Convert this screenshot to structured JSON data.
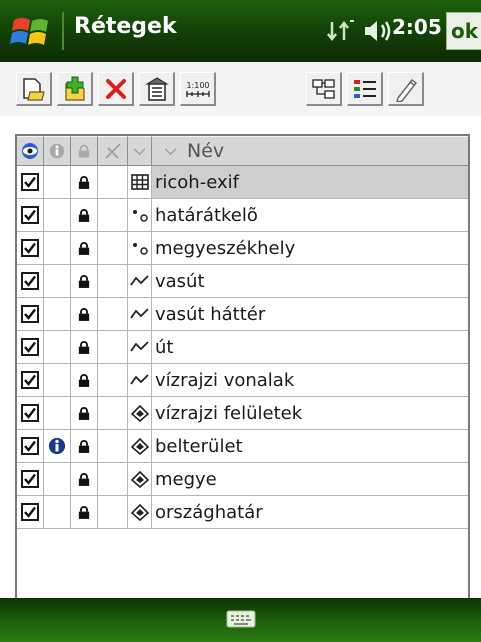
{
  "title_bar": {
    "title": "Rétegek",
    "time": "2:05",
    "ok_label": "ok",
    "icons": [
      "windows-start-icon",
      "connectivity-icon",
      "volume-icon"
    ]
  },
  "toolbar": {
    "buttons": [
      "open-layer-icon",
      "add-layer-icon",
      "delete-layer-icon",
      "layer-properties-icon",
      "scale-icon",
      "layer-tree-icon",
      "legend-icon",
      "edit-icon"
    ],
    "scale_label": "1:100"
  },
  "table": {
    "header": {
      "name_label": "Név",
      "columns": [
        "visible-column-icon",
        "info-column-icon",
        "lock-column-icon",
        "snap-column-icon",
        "type-column-icon"
      ]
    },
    "rows": [
      {
        "name": "ricoh-exif",
        "visible": true,
        "info": false,
        "locked": true,
        "type": "table",
        "selected": true
      },
      {
        "name": "határátkelõ",
        "visible": true,
        "info": false,
        "locked": true,
        "type": "point",
        "selected": false
      },
      {
        "name": "megyeszékhely",
        "visible": true,
        "info": false,
        "locked": true,
        "type": "point",
        "selected": false
      },
      {
        "name": "vasút",
        "visible": true,
        "info": false,
        "locked": true,
        "type": "line",
        "selected": false
      },
      {
        "name": "vasút háttér",
        "visible": true,
        "info": false,
        "locked": true,
        "type": "line",
        "selected": false
      },
      {
        "name": "út",
        "visible": true,
        "info": false,
        "locked": true,
        "type": "line",
        "selected": false
      },
      {
        "name": "vízrajzi vonalak",
        "visible": true,
        "info": false,
        "locked": true,
        "type": "line",
        "selected": false
      },
      {
        "name": "vízrajzi felületek",
        "visible": true,
        "info": false,
        "locked": true,
        "type": "polygon",
        "selected": false
      },
      {
        "name": "belterület",
        "visible": true,
        "info": true,
        "locked": true,
        "type": "polygon",
        "selected": false
      },
      {
        "name": "megye",
        "visible": true,
        "info": false,
        "locked": true,
        "type": "polygon",
        "selected": false
      },
      {
        "name": "országhatár",
        "visible": true,
        "info": false,
        "locked": true,
        "type": "polygon",
        "selected": false
      }
    ]
  },
  "bottom_bar": {
    "icons": [
      "keyboard-icon"
    ]
  },
  "colors": {
    "titlebar": "#123f07",
    "selected_row": "#cfcfcf",
    "header": "#d7d7d7"
  }
}
